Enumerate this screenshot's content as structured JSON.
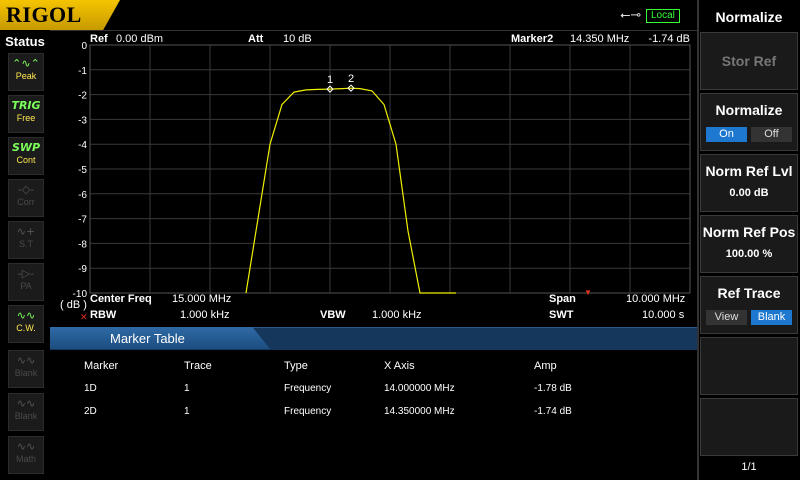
{
  "brand": "RIGOL",
  "usb_icon": "usb-icon",
  "remote_status": "Local",
  "status_panel": {
    "title": "Status",
    "items": [
      {
        "icon": "peak-icon",
        "label": "Peak",
        "active": true
      },
      {
        "icon": "trig-icon",
        "icon_text": "TRIG",
        "label": "Free",
        "active": true
      },
      {
        "icon": "swp-icon",
        "icon_text": "SWP",
        "label": "Cont",
        "active": true
      },
      {
        "icon": "corr-icon",
        "label": "Corr",
        "active": false
      },
      {
        "icon": "st-icon",
        "label": "S.T",
        "active": false
      },
      {
        "icon": "pa-icon",
        "label": "PA",
        "active": false
      },
      {
        "icon": "cw-icon",
        "label": "C.W.",
        "active": true
      },
      {
        "icon": "blank-icon",
        "label": "Blank",
        "active": false
      },
      {
        "icon": "blank-icon",
        "label": "Blank",
        "active": false
      },
      {
        "icon": "math-icon",
        "label": "Math",
        "active": false
      }
    ]
  },
  "measurement": {
    "ref_label": "Ref",
    "ref_value": "0.00 dBm",
    "att_label": "Att",
    "att_value": "10 dB",
    "marker_label": "Marker2",
    "marker_freq": "14.350 MHz",
    "marker_amp": "-1.74 dB",
    "unit_label": "( dB )",
    "center_freq_label": "Center Freq",
    "center_freq_value": "15.000 MHz",
    "span_label": "Span",
    "span_value": "10.000 MHz",
    "rbw_label": "RBW",
    "rbw_value": "1.000 kHz",
    "vbw_label": "VBW",
    "vbw_value": "1.000 kHz",
    "swt_label": "SWT",
    "swt_value": "10.000 s"
  },
  "chart_data": {
    "type": "line",
    "y_tick_labels": [
      "0",
      "-1",
      "-2",
      "-3",
      "-4",
      "-5",
      "-6",
      "-7",
      "-8",
      "-9",
      "-10"
    ],
    "ylim": [
      -10,
      0
    ],
    "xlim": [
      10.0,
      20.0
    ],
    "grid": true,
    "trace_color": "#f0f000",
    "grid_color": "#3a3a3a",
    "series": [
      {
        "x": [
          12.6,
          12.8,
          13.0,
          13.2,
          13.4,
          13.6,
          13.8,
          14.0,
          14.2,
          14.35,
          14.5,
          14.7,
          14.9,
          15.1,
          15.3,
          15.5,
          15.7,
          16.1
        ],
        "y": [
          -10.0,
          -7.0,
          -4.0,
          -2.4,
          -1.9,
          -1.81,
          -1.79,
          -1.78,
          -1.76,
          -1.74,
          -1.76,
          -1.85,
          -2.4,
          -4.0,
          -7.5,
          -10.0,
          -10.0,
          -10.0
        ]
      }
    ],
    "markers": [
      {
        "label": "1",
        "x": 14.0,
        "y": -1.78
      },
      {
        "label": "2",
        "x": 14.35,
        "y": -1.74
      }
    ]
  },
  "marker_table": {
    "title": "Marker Table",
    "headers": [
      "Marker",
      "Trace",
      "Type",
      "X Axis",
      "Amp"
    ],
    "rows": [
      [
        "1D",
        "1",
        "Frequency",
        "14.000000 MHz",
        "-1.78 dB"
      ],
      [
        "2D",
        "1",
        "Frequency",
        "14.350000 MHz",
        "-1.74 dB"
      ]
    ]
  },
  "menu": {
    "title": "Normalize",
    "items": [
      {
        "label": "Stor Ref",
        "enabled": false
      },
      {
        "label": "Normalize",
        "toggle": [
          "On",
          "Off"
        ],
        "selected": "On"
      },
      {
        "label": "Norm Ref Lvl",
        "value": "0.00 dB"
      },
      {
        "label": "Norm Ref Pos",
        "value": "100.00 %"
      },
      {
        "label": "Ref Trace",
        "toggle": [
          "View",
          "Blank"
        ],
        "selected": "Blank"
      }
    ],
    "page": "1/1"
  },
  "colors": {
    "accent_yellow": "#f5c400",
    "active_green": "#7cff5a",
    "toggle_blue": "#1e78d0",
    "table_header_blue": "#1c4d80"
  }
}
